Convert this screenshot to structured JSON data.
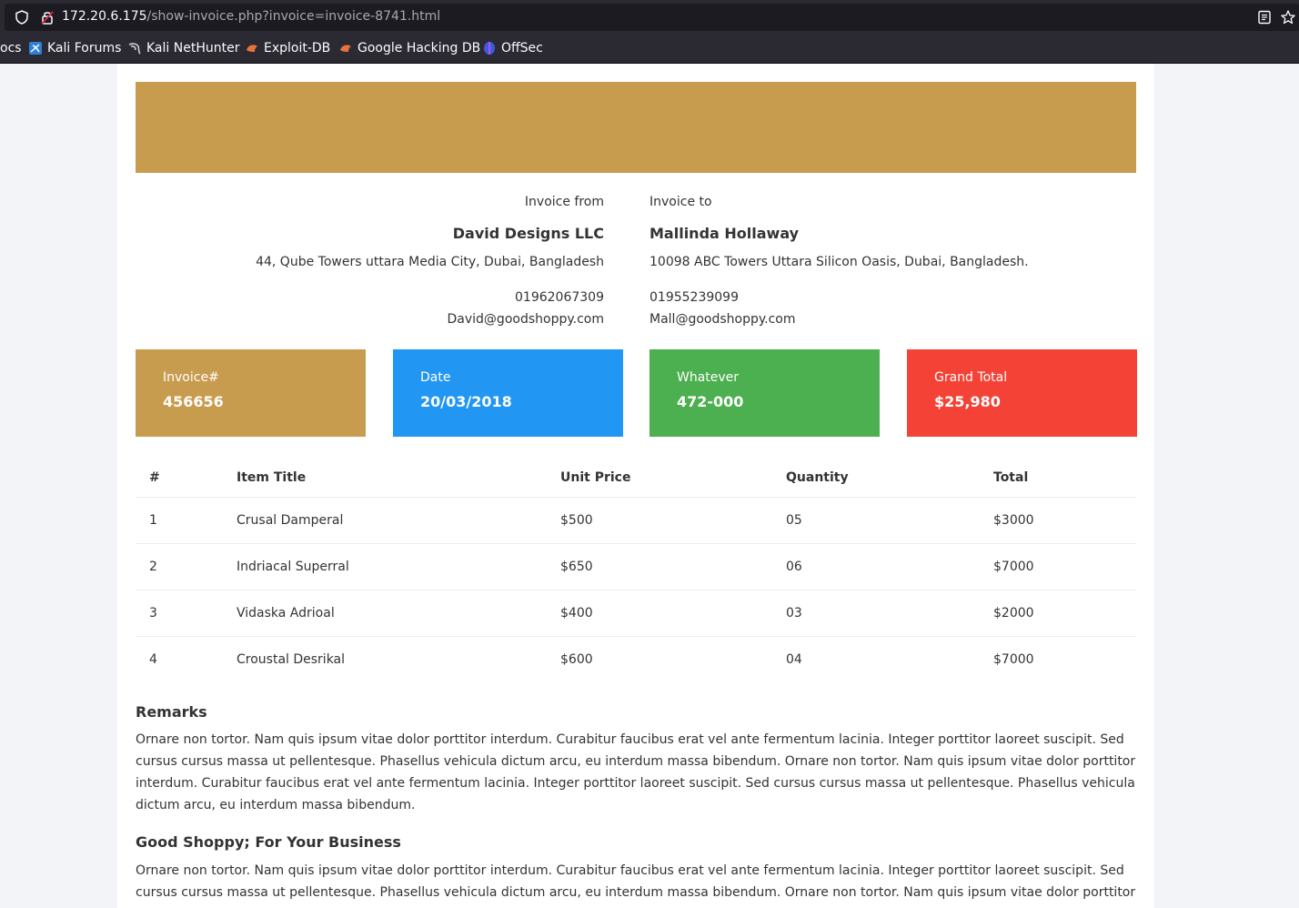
{
  "browser": {
    "url_host": "172.20.6.175",
    "url_path": "/show-invoice.php?invoice=invoice-8741.html",
    "bookmarks": [
      {
        "label": "ocs",
        "icon": "none"
      },
      {
        "label": "Kali Forums",
        "icon": "kali-forums-icon"
      },
      {
        "label": "Kali NetHunter",
        "icon": "kali-nethunter-icon"
      },
      {
        "label": "Exploit-DB",
        "icon": "exploit-db-icon"
      },
      {
        "label": "Google Hacking DB",
        "icon": "ghdb-icon"
      },
      {
        "label": "OffSec",
        "icon": "offsec-icon"
      }
    ]
  },
  "colors": {
    "brand": "#c89c4e",
    "date_card": "#2196f3",
    "whatever_card": "#4caf50",
    "total_card": "#f44336"
  },
  "invoice": {
    "from": {
      "label": "Invoice from",
      "name": "David Designs LLC",
      "address": "44, Qube Towers uttara Media City, Dubai, Bangladesh",
      "phone": "01962067309",
      "email": "David@goodshoppy.com"
    },
    "to": {
      "label": "Invoice to",
      "name": "Mallinda Hollaway",
      "address": "10098 ABC Towers Uttara Silicon Oasis, Dubai, Bangladesh.",
      "phone": "01955239099",
      "email": "Mall@goodshoppy.com"
    },
    "cards": [
      {
        "label": "Invoice#",
        "value": "456656"
      },
      {
        "label": "Date",
        "value": "20/03/2018"
      },
      {
        "label": "Whatever",
        "value": "472-000"
      },
      {
        "label": "Grand Total",
        "value": "$25,980"
      }
    ],
    "table": {
      "headers": [
        "#",
        "Item Title",
        "Unit Price",
        "Quantity",
        "Total"
      ],
      "rows": [
        [
          "1",
          "Crusal Damperal",
          "$500",
          "05",
          "$3000"
        ],
        [
          "2",
          "Indriacal Superral",
          "$650",
          "06",
          "$7000"
        ],
        [
          "3",
          "Vidaska Adrioal",
          "$400",
          "03",
          "$2000"
        ],
        [
          "4",
          "Croustal Desrikal",
          "$600",
          "04",
          "$7000"
        ]
      ]
    },
    "remarks": {
      "title": "Remarks",
      "text": "Ornare non tortor. Nam quis ipsum vitae dolor porttitor interdum. Curabitur faucibus erat vel ante fermentum lacinia. Integer porttitor laoreet suscipit. Sed cursus cursus massa ut pellentesque. Phasellus vehicula dictum arcu, eu interdum massa bibendum. Ornare non tortor. Nam quis ipsum vitae dolor porttitor interdum. Curabitur faucibus erat vel ante fermentum lacinia. Integer porttitor laoreet suscipit. Sed cursus cursus massa ut pellentesque. Phasellus vehicula dictum arcu, eu interdum massa bibendum."
    },
    "business": {
      "title": "Good Shoppy; For Your Business",
      "text": "Ornare non tortor. Nam quis ipsum vitae dolor porttitor interdum. Curabitur faucibus erat vel ante fermentum lacinia. Integer porttitor laoreet suscipit. Sed cursus cursus massa ut pellentesque. Phasellus vehicula dictum arcu, eu interdum massa bibendum. Ornare non tortor. Nam quis ipsum vitae dolor porttitor"
    }
  }
}
